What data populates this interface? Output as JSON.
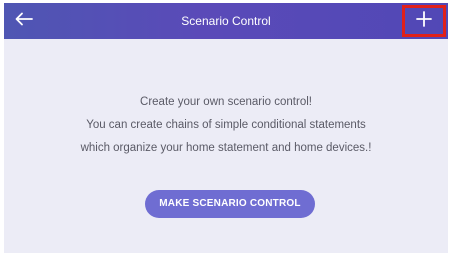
{
  "header": {
    "title": "Scenario Control",
    "back_icon": "arrow-left-icon",
    "add_icon": "plus-icon",
    "gradient": [
      "#4f56b3",
      "#5148b6"
    ],
    "highlight_color": "#e0201a"
  },
  "empty_state": {
    "line1": "Create your own scenario control!",
    "line2": "You can create chains of simple conditional statements",
    "line3": "which organize your home statement and home devices.!",
    "button_label": "MAKE SCENARIO CONTROL",
    "button_color": "#6f6dd2"
  }
}
